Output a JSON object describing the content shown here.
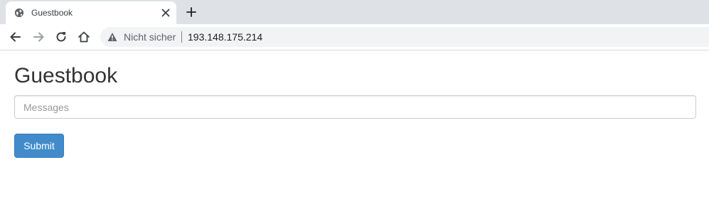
{
  "browser": {
    "tab": {
      "title": "Guestbook",
      "favicon": "globe-icon"
    },
    "toolbar": {
      "icons": [
        "back-arrow-icon",
        "forward-arrow-icon",
        "reload-icon",
        "home-icon"
      ],
      "security_label": "Nicht sicher",
      "security_icon": "warning-icon",
      "url": "193.148.175.214"
    },
    "colors": {
      "tabstrip": "#dee1e6",
      "omnibox": "#f1f3f4"
    }
  },
  "page": {
    "title": "Guestbook",
    "message_input": {
      "placeholder": "Messages",
      "value": ""
    },
    "submit_label": "Submit",
    "colors": {
      "button": "#428bca",
      "title_text": "#333333"
    }
  }
}
